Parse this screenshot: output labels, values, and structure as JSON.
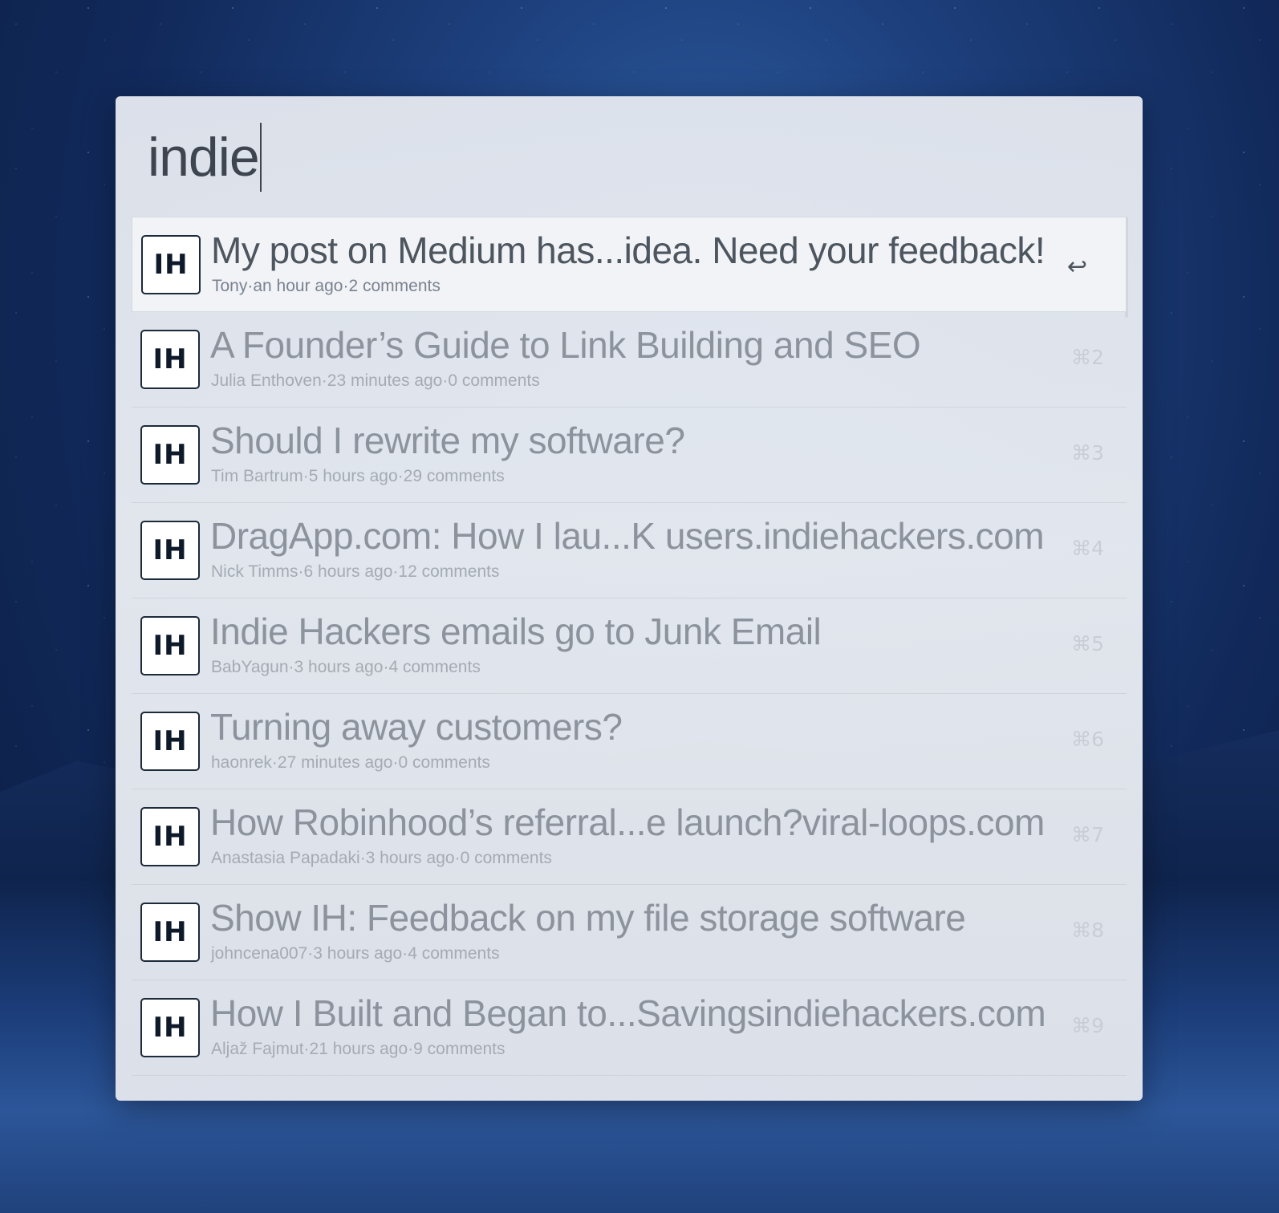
{
  "search": {
    "value": "indie"
  },
  "results": [
    {
      "title": "My post on Medium has...idea. Need your feedback!",
      "author": "Tony",
      "time": "an hour ago",
      "comments": "2 comments",
      "shortcut": "↩",
      "logo": "IH"
    },
    {
      "title": "A Founder’s Guide to Link Building and SEO",
      "author": "Julia Enthoven",
      "time": "23 minutes ago",
      "comments": "0 comments",
      "shortcut": "⌘2",
      "logo": "IH"
    },
    {
      "title": "Should I rewrite my software?",
      "author": "Tim Bartrum",
      "time": "5 hours ago",
      "comments": "29 comments",
      "shortcut": "⌘3",
      "logo": "IH"
    },
    {
      "title": "DragApp.com: How I lau...K users.indiehackers.com",
      "author": "Nick Timms",
      "time": "6 hours ago",
      "comments": "12 comments",
      "shortcut": "⌘4",
      "logo": "IH"
    },
    {
      "title": "Indie Hackers emails go to Junk Email",
      "author": "BabYagun",
      "time": "3 hours ago",
      "comments": "4 comments",
      "shortcut": "⌘5",
      "logo": "IH"
    },
    {
      "title": "Turning away customers?",
      "author": "haonrek",
      "time": "27 minutes ago",
      "comments": "0 comments",
      "shortcut": "⌘6",
      "logo": "IH"
    },
    {
      "title": "How Robinhood’s referral...e launch?viral-loops.com",
      "author": "Anastasia Papadaki",
      "time": "3 hours ago",
      "comments": "0 comments",
      "shortcut": "⌘7",
      "logo": "IH"
    },
    {
      "title": "Show IH: Feedback on my file storage software",
      "author": "johncena007",
      "time": "3 hours ago",
      "comments": "4 comments",
      "shortcut": "⌘8",
      "logo": "IH"
    },
    {
      "title": "How I Built and Began to...Savingsindiehackers.com",
      "author": "Aljaž Fajmut",
      "time": "21 hours ago",
      "comments": "9 comments",
      "shortcut": "⌘9",
      "logo": "IH"
    }
  ],
  "separator": "·",
  "colors": {
    "panel": "#e4e8ef",
    "title_selected": "#4d555f",
    "title": "#8c939c",
    "meta": "#a5abb3",
    "logo_border": "#1c2a3a"
  }
}
